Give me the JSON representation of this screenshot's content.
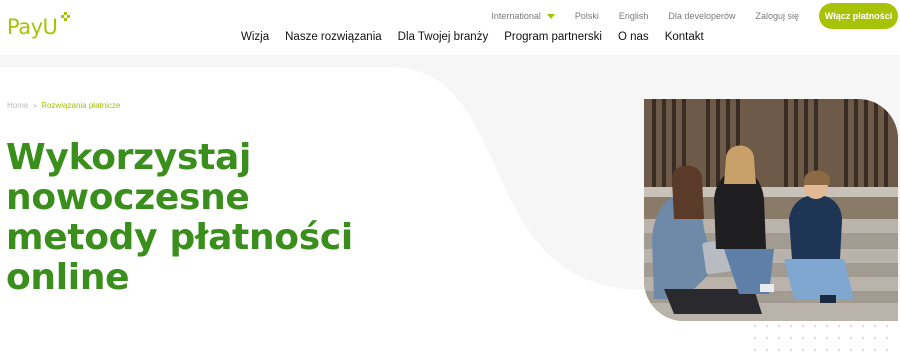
{
  "header": {
    "logo_text": "PayU",
    "top_nav": {
      "language_selector": "International",
      "links": [
        "Polski",
        "English",
        "Dla developerów",
        "Zaloguj się"
      ],
      "cta_label": "Włącz płatności"
    },
    "main_nav": [
      "Wizja",
      "Nasze rozwiązania",
      "Dla Twojej branży",
      "Program partnerski",
      "O nas",
      "Kontakt"
    ]
  },
  "breadcrumb": {
    "home": "Home",
    "separator": "»",
    "current": "Rozwiązania płatnicze"
  },
  "hero": {
    "headline_lines": [
      "Wykorzystaj",
      "nowoczesne",
      "metody płatności",
      "online"
    ]
  },
  "colors": {
    "brand_green": "#a6c307",
    "headline_green": "#3a8f1c",
    "hero_bg": "#f6f6f6"
  }
}
